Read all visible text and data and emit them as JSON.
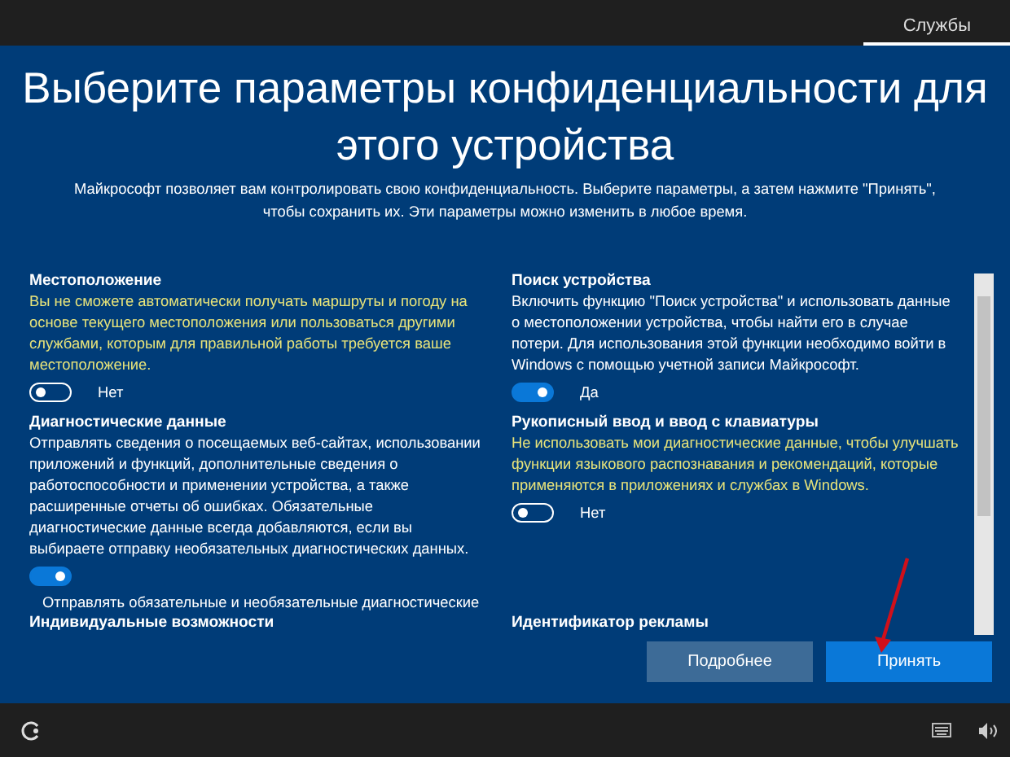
{
  "top_bar": {
    "tab": "Службы"
  },
  "title": "Выберите параметры конфиденциальности для этого устройства",
  "subtitle": "Майкрософт позволяет вам контролировать свою конфиденциальность. Выберите параметры, а затем нажмите \"Принять\", чтобы сохранить их. Эти параметры можно изменить в любое время.",
  "settings": [
    {
      "kind": "inline",
      "title": "Местоположение",
      "description": "Вы не сможете автоматически получать маршруты и погоду на основе текущего местоположения или пользоваться другими службами, которым для правильной работы требуется ваше местоположение.",
      "on": false,
      "toggle_label": "Нет"
    },
    {
      "kind": "inline",
      "title": "Поиск устройства",
      "description": "Включить функцию \"Поиск устройства\" и использовать данные о местоположении устройства, чтобы найти его в случае потери. Для использования этой функции необходимо войти в Windows с помощью учетной записи Майкрософт.",
      "on": true,
      "toggle_label": "Да"
    },
    {
      "kind": "stacked",
      "title": "Диагностические данные",
      "description": "Отправлять сведения о посещаемых веб-сайтах, использовании приложений и функций, дополнительные сведения о работоспособности и применении устройства, а также расширенные отчеты об ошибках. Обязательные диагностические данные всегда добавляются, если вы выбираете отправку необязательных диагностических данных.",
      "on": true,
      "toggle_label": "Отправлять обязательные и необязательные диагностические"
    },
    {
      "kind": "inline",
      "title": "Рукописный ввод и ввод с клавиатуры",
      "description": "Не использовать мои диагностические данные, чтобы улучшать функции языкового распознавания и рекомендаций, которые применяются в приложениях и службах в Windows.",
      "on": false,
      "toggle_label": "Нет"
    },
    {
      "kind": "title",
      "title": "Индивидуальные возможности"
    },
    {
      "kind": "title",
      "title": "Идентификатор рекламы"
    }
  ],
  "buttons": [
    {
      "label": "Подробнее",
      "kind": "secondary"
    },
    {
      "label": "Принять",
      "kind": "primary"
    }
  ]
}
